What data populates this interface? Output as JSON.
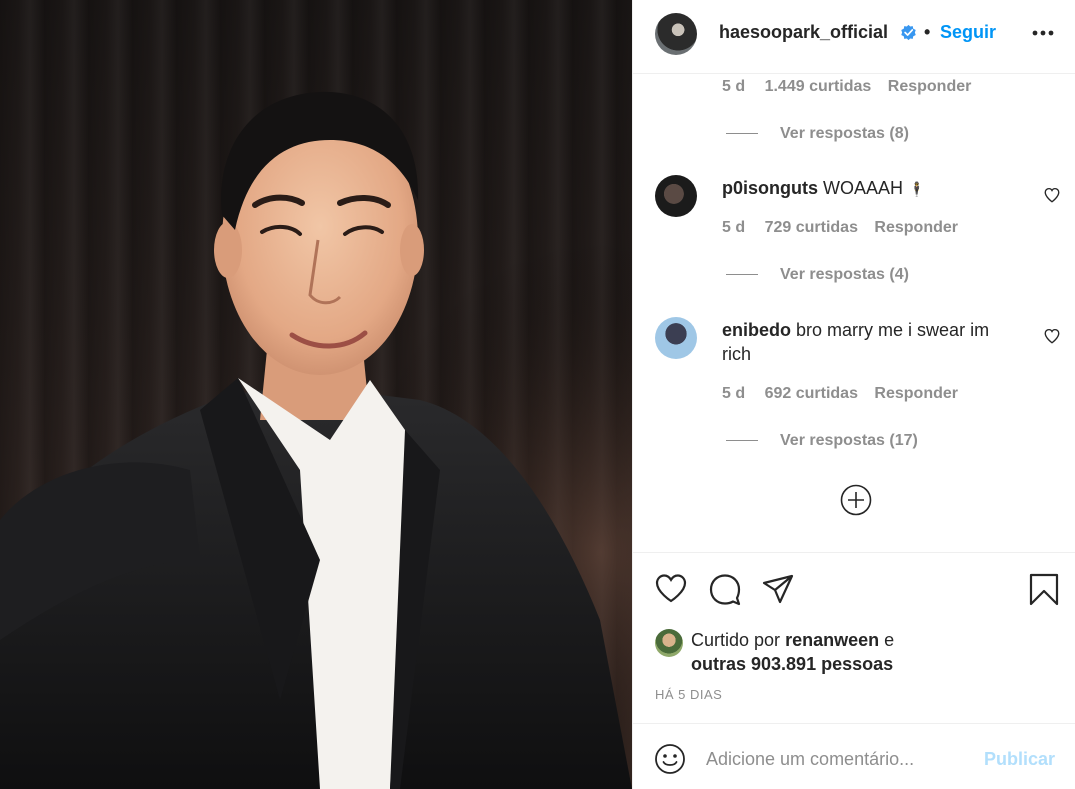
{
  "post": {
    "image_alt": "Selfie of a man in a dark suit and white shirt in front of dark curtains"
  },
  "header": {
    "username": "haesoopark_official",
    "separator": "•",
    "follow_label": "Seguir",
    "verified_icon": "verified-badge-icon",
    "more_icon": "more-options-icon"
  },
  "comments": [
    {
      "time": "5 d",
      "likes": "1.449 curtidas",
      "reply_label": "Responder",
      "view_replies": "Ver respostas (8)"
    },
    {
      "user": "p0isonguts",
      "text": "WOAAAH",
      "emoji": "🕴",
      "time": "5 d",
      "likes": "729 curtidas",
      "reply_label": "Responder",
      "view_replies": "Ver respostas (4)"
    },
    {
      "user": "enibedo",
      "text": "bro marry me i swear im rich",
      "time": "5 d",
      "likes": "692 curtidas",
      "reply_label": "Responder",
      "view_replies": "Ver respostas (17)"
    }
  ],
  "actions": {
    "like_icon": "heart-icon",
    "comment_icon": "comment-icon",
    "share_icon": "paper-plane-icon",
    "save_icon": "bookmark-icon"
  },
  "likes": {
    "prefix": "Curtido por",
    "user": "renanween",
    "connector": "e",
    "others": "outras 903.891 pessoas"
  },
  "posted_ago": "HÁ 5 DIAS",
  "add_comment": {
    "placeholder": "Adicione um comentário...",
    "publish_label": "Publicar"
  },
  "colors": {
    "accent": "#0095f6",
    "publish_disabled": "#b2dffc",
    "muted": "#8e8e8e",
    "text": "#262626"
  }
}
